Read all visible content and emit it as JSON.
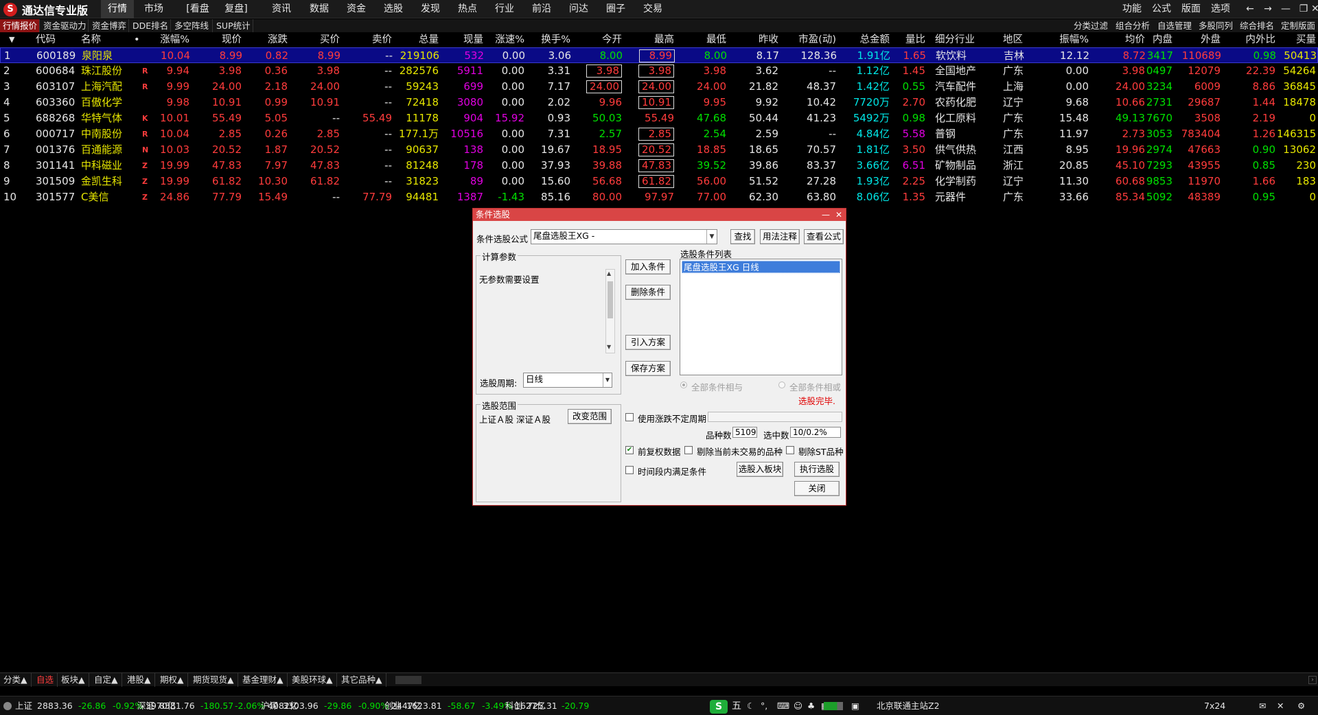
{
  "app": {
    "title": "通达信专业版",
    "logo_icon": "tdx-logo-icon"
  },
  "menu": {
    "items": [
      "行情",
      "市场",
      "[看盘",
      "复盘]",
      "资讯",
      "数据",
      "资金",
      "选股",
      "发现",
      "热点",
      "行业",
      "前沿",
      "问达",
      "圈子",
      "交易"
    ],
    "active": 0,
    "right": [
      "功能",
      "公式",
      "版面",
      "选项"
    ]
  },
  "tabs": {
    "items": [
      "行情报价",
      "资金驱动力",
      "资金博弈",
      "DDE排名",
      "多空阵线",
      "SUP统计"
    ],
    "active": 0,
    "right": [
      "分类过滤",
      "组合分析",
      "自选管理",
      "多股同列",
      "综合排名",
      "定制版面"
    ]
  },
  "table": {
    "sort_arrow": "▼",
    "dot": "•",
    "headers": [
      "代码",
      "名称",
      "涨幅%",
      "现价",
      "涨跌",
      "买价",
      "卖价",
      "总量",
      "现量",
      "涨速%",
      "换手%",
      "今开",
      "最高",
      "最低",
      "昨收",
      "市盈(动)",
      "总金额",
      "量比",
      "细分行业",
      "地区",
      "振幅%",
      "均价",
      "内盘",
      "外盘",
      "内外比",
      "买量"
    ],
    "rows": [
      {
        "no": "1",
        "code": "600189",
        "name": "泉阳泉",
        "flag": "",
        "chg": "10.04",
        "price": "8.99",
        "diff": "0.82",
        "bid": "8.99",
        "ask": "--",
        "vol": "219106",
        "cur": "532",
        "speed": "0.00",
        "turn": "3.06",
        "open": "8.00",
        "high": "8.99",
        "low": "8.00",
        "prev": "8.17",
        "pe": "128.36",
        "amt": "1.91亿",
        "vr": "1.65",
        "ind": "软饮料",
        "region": "吉林",
        "amp": "12.12",
        "avg": "8.72",
        "inner": "3417",
        "outer": "110689",
        "ratio": "0.98",
        "bidvol": "50413"
      },
      {
        "no": "2",
        "code": "600684",
        "name": "珠江股份",
        "flag": "R",
        "chg": "9.94",
        "price": "3.98",
        "diff": "0.36",
        "bid": "3.98",
        "ask": "--",
        "vol": "282576",
        "cur": "5911",
        "speed": "0.00",
        "turn": "3.31",
        "open": "3.98",
        "high": "3.98",
        "low": "3.98",
        "prev": "3.62",
        "pe": "--",
        "amt": "1.12亿",
        "vr": "1.45",
        "ind": "全国地产",
        "region": "广东",
        "amp": "0.00",
        "avg": "3.98",
        "inner": "0497",
        "outer": "12079",
        "ratio": "22.39",
        "bidvol": "54264"
      },
      {
        "no": "3",
        "code": "603107",
        "name": "上海汽配",
        "flag": "R",
        "chg": "9.99",
        "price": "24.00",
        "diff": "2.18",
        "bid": "24.00",
        "ask": "--",
        "vol": "59243",
        "cur": "699",
        "speed": "0.00",
        "turn": "7.17",
        "open": "24.00",
        "high": "24.00",
        "low": "24.00",
        "prev": "21.82",
        "pe": "48.37",
        "amt": "1.42亿",
        "vr": "0.55",
        "ind": "汽车配件",
        "region": "上海",
        "amp": "0.00",
        "avg": "24.00",
        "inner": "3234",
        "outer": "6009",
        "ratio": "8.86",
        "bidvol": "36845"
      },
      {
        "no": "4",
        "code": "603360",
        "name": "百傲化学",
        "flag": "",
        "chg": "9.98",
        "price": "10.91",
        "diff": "0.99",
        "bid": "10.91",
        "ask": "--",
        "vol": "72418",
        "cur": "3080",
        "speed": "0.00",
        "turn": "2.02",
        "open": "9.96",
        "high": "10.91",
        "low": "9.95",
        "prev": "9.92",
        "pe": "10.42",
        "amt": "7720万",
        "vr": "2.70",
        "ind": "农药化肥",
        "region": "辽宁",
        "amp": "9.68",
        "avg": "10.66",
        "inner": "2731",
        "outer": "29687",
        "ratio": "1.44",
        "bidvol": "18478"
      },
      {
        "no": "5",
        "code": "688268",
        "name": "华特气体",
        "flag": "K",
        "chg": "10.01",
        "price": "55.49",
        "diff": "5.05",
        "bid": "--",
        "ask": "55.49",
        "vol": "11178",
        "cur": "904",
        "speed": "15.92",
        "turn": "0.93",
        "open": "50.03",
        "high": "55.49",
        "low": "47.68",
        "prev": "50.44",
        "pe": "41.23",
        "amt": "5492万",
        "vr": "0.98",
        "ind": "化工原料",
        "region": "广东",
        "amp": "15.48",
        "avg": "49.13",
        "inner": "7670",
        "outer": "3508",
        "ratio": "2.19",
        "bidvol": "0"
      },
      {
        "no": "6",
        "code": "000717",
        "name": "中南股份",
        "flag": "R",
        "chg": "10.04",
        "price": "2.85",
        "diff": "0.26",
        "bid": "2.85",
        "ask": "--",
        "vol": "177.1万",
        "cur": "10516",
        "speed": "0.00",
        "turn": "7.31",
        "open": "2.57",
        "high": "2.85",
        "low": "2.54",
        "prev": "2.59",
        "pe": "--",
        "amt": "4.84亿",
        "vr": "5.58",
        "ind": "普钢",
        "region": "广东",
        "amp": "11.97",
        "avg": "2.73",
        "inner": "3053",
        "outer": "783404",
        "ratio": "1.26",
        "bidvol": "146315"
      },
      {
        "no": "7",
        "code": "001376",
        "name": "百通能源",
        "flag": "N",
        "chg": "10.03",
        "price": "20.52",
        "diff": "1.87",
        "bid": "20.52",
        "ask": "--",
        "vol": "90637",
        "cur": "138",
        "speed": "0.00",
        "turn": "19.67",
        "open": "18.95",
        "high": "20.52",
        "low": "18.85",
        "prev": "18.65",
        "pe": "70.57",
        "amt": "1.81亿",
        "vr": "3.50",
        "ind": "供气供热",
        "region": "江西",
        "amp": "8.95",
        "avg": "19.96",
        "inner": "2974",
        "outer": "47663",
        "ratio": "0.90",
        "bidvol": "13062"
      },
      {
        "no": "8",
        "code": "301141",
        "name": "中科磁业",
        "flag": "Z",
        "chg": "19.99",
        "price": "47.83",
        "diff": "7.97",
        "bid": "47.83",
        "ask": "--",
        "vol": "81248",
        "cur": "178",
        "speed": "0.00",
        "turn": "37.93",
        "open": "39.88",
        "high": "47.83",
        "low": "39.52",
        "prev": "39.86",
        "pe": "83.37",
        "amt": "3.66亿",
        "vr": "6.51",
        "ind": "矿物制品",
        "region": "浙江",
        "amp": "20.85",
        "avg": "45.10",
        "inner": "7293",
        "outer": "43955",
        "ratio": "0.85",
        "bidvol": "230"
      },
      {
        "no": "9",
        "code": "301509",
        "name": "金凯生科",
        "flag": "Z",
        "chg": "19.99",
        "price": "61.82",
        "diff": "10.30",
        "bid": "61.82",
        "ask": "--",
        "vol": "31823",
        "cur": "89",
        "speed": "0.00",
        "turn": "15.60",
        "open": "56.68",
        "high": "61.82",
        "low": "56.00",
        "prev": "51.52",
        "pe": "27.28",
        "amt": "1.93亿",
        "vr": "2.25",
        "ind": "化学制药",
        "region": "辽宁",
        "amp": "11.30",
        "avg": "60.68",
        "inner": "9853",
        "outer": "11970",
        "ratio": "1.66",
        "bidvol": "183"
      },
      {
        "no": "10",
        "code": "301577",
        "name": "C美信",
        "flag": "Z",
        "chg": "24.86",
        "price": "77.79",
        "diff": "15.49",
        "bid": "--",
        "ask": "77.79",
        "vol": "94481",
        "cur": "1387",
        "speed": "-1.43",
        "turn": "85.16",
        "open": "80.00",
        "high": "97.97",
        "low": "77.00",
        "prev": "62.30",
        "pe": "63.80",
        "amt": "8.06亿",
        "vr": "1.35",
        "ind": "元器件",
        "region": "广东",
        "amp": "33.66",
        "avg": "85.34",
        "inner": "5092",
        "outer": "48389",
        "ratio": "0.95",
        "bidvol": "0"
      }
    ]
  },
  "bottom_tabs": [
    "分类▲",
    "自选",
    "板块▲",
    "自定▲",
    "港股▲",
    "期权▲",
    "期货现货▲",
    "基金理财▲",
    "美股环球▲",
    "其它品种▲"
  ],
  "status": {
    "items": [
      {
        "label": "上证",
        "val": "2883.36",
        "chg": "-26.86",
        "pct": "-0.92%",
        "amt": "3970亿"
      },
      {
        "label": "深证",
        "val": "8581.76",
        "chg": "-180.57",
        "pct": "-2.06%",
        "amt": "4082亿"
      },
      {
        "label": "沪深",
        "val": "3303.96",
        "chg": "-29.86",
        "pct": "-0.90%",
        "amt": "2447亿"
      },
      {
        "label": "创业",
        "val": "1623.81",
        "chg": "-58.67",
        "pct": "-3.49%",
        "amt": "1627亿"
      },
      {
        "label": "科创",
        "val": "725.31",
        "chg": "-20.79",
        "pct": "",
        "amt": ""
      }
    ],
    "server": "北京联通主站Z2",
    "mode": "7x24",
    "ime": "五"
  },
  "dialog": {
    "title": "条件选股",
    "formula_label": "条件选股公式",
    "formula_value": "尾盘选股王XG -",
    "btn_find": "查找",
    "btn_usage": "用法注释",
    "btn_view": "查看公式",
    "params_title": "计算参数",
    "params_text": "无参数需要设置",
    "period_label": "选股周期:",
    "period_value": "日线",
    "btn_add": "加入条件",
    "btn_delete": "删除条件",
    "btn_import": "引入方案",
    "btn_save": "保存方案",
    "list_title": "选股条件列表",
    "list_items": [
      "尾盘选股王XG  日线"
    ],
    "radio_and": "全部条件相与",
    "radio_or": "全部条件相或",
    "done_text": "选股完毕.",
    "range_title": "选股范围",
    "range_text": "上证Ａ股 深证Ａ股",
    "btn_change_range": "改变范围",
    "use_period_label": "使用涨跌不定周期",
    "count_label": "品种数",
    "count_value": "5109",
    "selected_label": "选中数",
    "selected_value": "10/0.2%",
    "chk_prev": "前复权数据",
    "chk_remove_untraded": "剔除当前未交易的品种",
    "chk_remove_st": "剔除ST品种",
    "chk_time": "时间段内满足条件",
    "btn_to_block": "选股入板块",
    "btn_execute": "执行选股",
    "btn_close": "关闭"
  }
}
